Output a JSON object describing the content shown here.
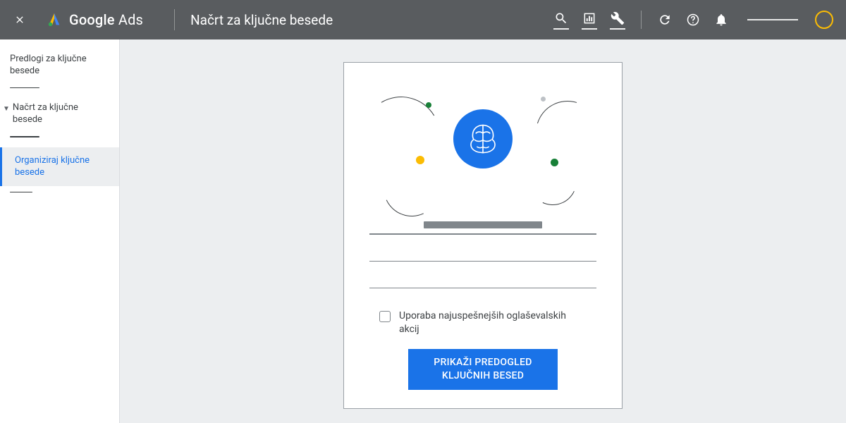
{
  "header": {
    "brand_bold": "Google",
    "brand_rest": " Ads",
    "page_title": "Načrt za ključne besede"
  },
  "sidebar": {
    "item_suggestions": "Predlogi za ključne besede",
    "item_plan": "Načrt za ključne besede",
    "item_organize": "Organiziraj ključne besede"
  },
  "card": {
    "checkbox_label": "Uporaba najuspešnejših oglaševalskih akcij",
    "cta_label": "PRIKAŽI PREDOGLED KLJUČNIH BESED"
  },
  "icons": {
    "close": "close-icon",
    "search": "search-icon",
    "reports": "reports-icon",
    "tools": "tools-icon",
    "refresh": "refresh-icon",
    "help": "help-icon",
    "notifications": "notifications-icon"
  }
}
